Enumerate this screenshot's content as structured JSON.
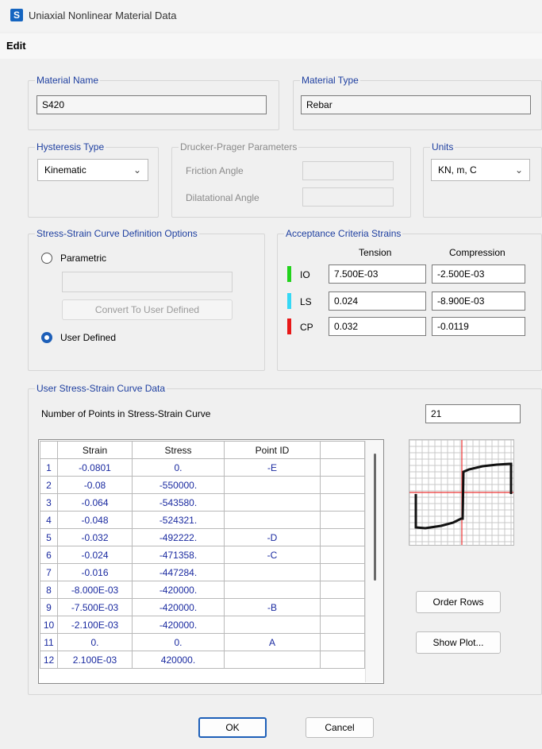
{
  "window": {
    "title": "Uniaxial Nonlinear Material Data",
    "app_icon_letter": "S"
  },
  "menu": {
    "edit": "Edit"
  },
  "material_name": {
    "legend": "Material Name",
    "value": "S420"
  },
  "material_type": {
    "legend": "Material Type",
    "value": "Rebar"
  },
  "hysteresis": {
    "legend": "Hysteresis Type",
    "value": "Kinematic"
  },
  "drucker": {
    "legend": "Drucker-Prager Parameters",
    "friction_label": "Friction Angle",
    "dilatational_label": "Dilatational Angle",
    "friction_value": "",
    "dilatational_value": ""
  },
  "units": {
    "legend": "Units",
    "value": "KN, m, C"
  },
  "options": {
    "legend": "Stress-Strain Curve Definition Options",
    "parametric_label": "Parametric",
    "parametric_value": "",
    "convert_button": "Convert To User Defined",
    "user_defined_label": "User Defined",
    "selected": "user_defined"
  },
  "acceptance": {
    "legend": "Acceptance Criteria Strains",
    "tension_header": "Tension",
    "compression_header": "Compression",
    "rows": [
      {
        "label": "IO",
        "color": "#22d31c",
        "tension": "7.500E-03",
        "compression": "-2.500E-03"
      },
      {
        "label": "LS",
        "color": "#35d8f5",
        "tension": "0.024",
        "compression": "-8.900E-03"
      },
      {
        "label": "CP",
        "color": "#e81818",
        "tension": "0.032",
        "compression": "-0.0119"
      }
    ]
  },
  "curve": {
    "legend": "User Stress-Strain Curve Data",
    "num_points_label": "Number of Points in Stress-Strain Curve",
    "num_points": "21",
    "headers": [
      "",
      "Strain",
      "Stress",
      "Point ID"
    ],
    "rows": [
      [
        "1",
        "-0.0801",
        "0.",
        "-E"
      ],
      [
        "2",
        "-0.08",
        "-550000.",
        ""
      ],
      [
        "3",
        "-0.064",
        "-543580.",
        ""
      ],
      [
        "4",
        "-0.048",
        "-524321.",
        ""
      ],
      [
        "5",
        "-0.032",
        "-492222.",
        "-D"
      ],
      [
        "6",
        "-0.024",
        "-471358.",
        "-C"
      ],
      [
        "7",
        "-0.016",
        "-447284.",
        ""
      ],
      [
        "8",
        "-8.000E-03",
        "-420000.",
        ""
      ],
      [
        "9",
        "-7.500E-03",
        "-420000.",
        "-B"
      ],
      [
        "10",
        "-2.100E-03",
        "-420000.",
        ""
      ],
      [
        "11",
        "0.",
        "0.",
        "A"
      ],
      [
        "12",
        "2.100E-03",
        "420000.",
        ""
      ]
    ],
    "order_rows_button": "Order Rows",
    "show_plot_button": "Show Plot..."
  },
  "buttons": {
    "ok": "OK",
    "cancel": "Cancel"
  },
  "colors": {
    "legend_blue": "#1e3fa0",
    "value_blue": "#1a2aa0",
    "primary_border": "#1d5fb8"
  }
}
